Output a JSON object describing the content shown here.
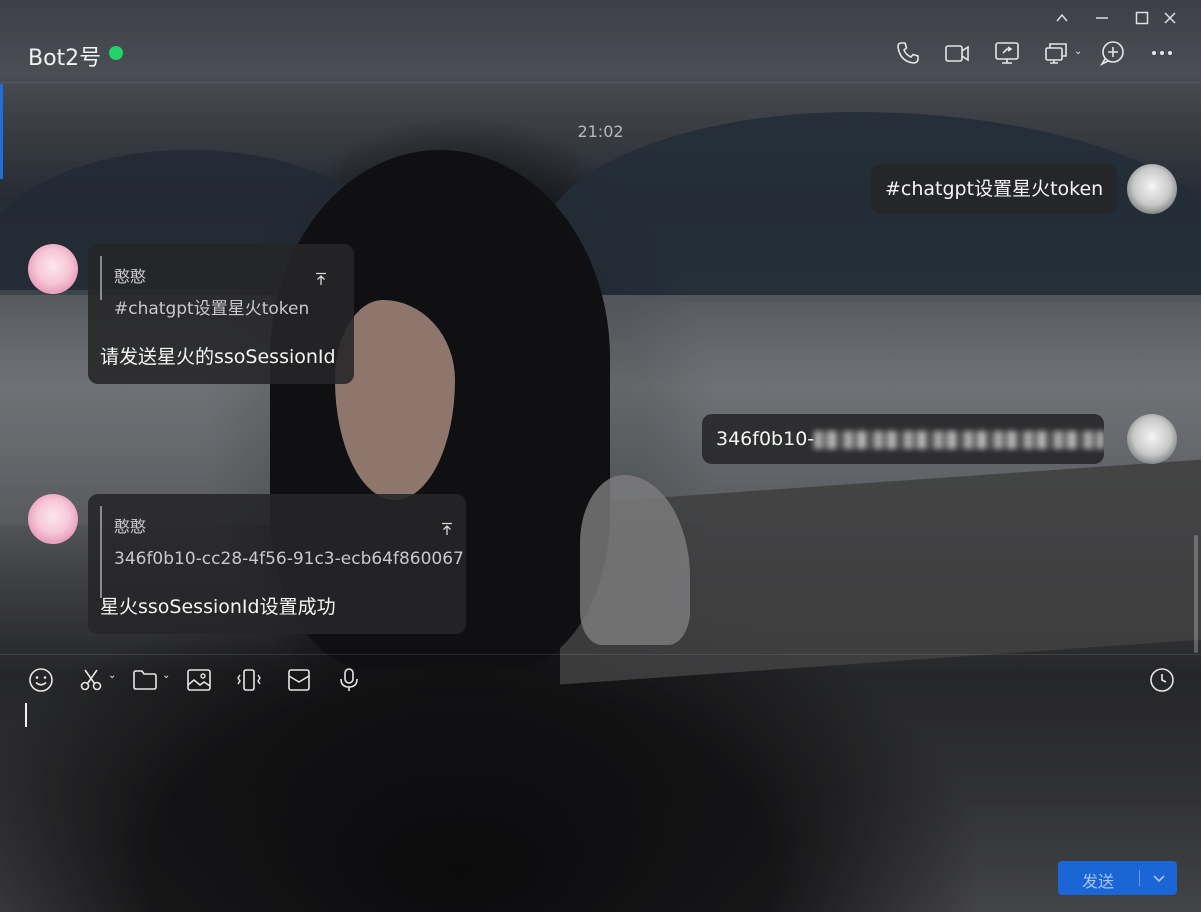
{
  "header": {
    "title": "Bot2号",
    "status_color": "#22d36b",
    "icons": [
      "phone-icon",
      "video-camera-icon",
      "screen-share-icon",
      "remote-desktop-icon",
      "add-icon",
      "more-icon"
    ]
  },
  "window_controls": [
    "collapse-icon",
    "minimize-icon",
    "maximize-icon",
    "close-icon"
  ],
  "chat": {
    "timestamp": "21:02",
    "messages": [
      {
        "side": "right",
        "text": "#chatgpt设置星火token"
      },
      {
        "side": "left",
        "quote_name": "憨憨",
        "quote_text": "#chatgpt设置星火token",
        "text": "请发送星火的ssoSessionId"
      },
      {
        "side": "right",
        "text": "346f0b10-"
      },
      {
        "side": "left",
        "quote_name": "憨憨",
        "quote_text": "346f0b10-cc28-4f56-91c3-ecb64f860067",
        "text": "星火ssoSessionId设置成功"
      }
    ]
  },
  "toolbar": {
    "icons": [
      "emoji-icon",
      "scissors-icon",
      "folder-icon",
      "image-icon",
      "shake-icon",
      "mailbox-icon",
      "microphone-icon",
      "history-icon"
    ]
  },
  "input": {
    "value": ""
  },
  "send": {
    "label": "发送",
    "color": "#1a66d6"
  }
}
